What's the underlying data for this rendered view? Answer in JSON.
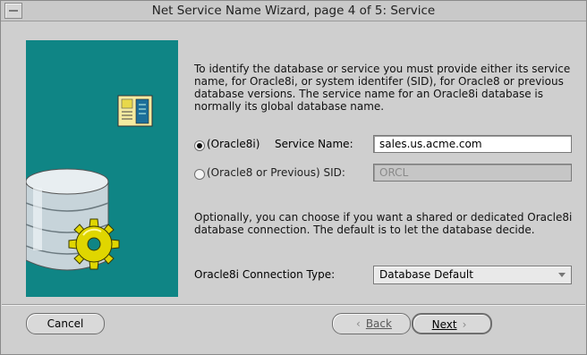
{
  "window": {
    "title": "Net Service Name Wizard, page 4 of 5: Service"
  },
  "intro_text": "To identify the database or service you must provide either its service name, for Oracle8i, or system identifer (SID), for Oracle8 or previous database versions. The service name for an Oracle8i database is normally its global database name.",
  "service_option": {
    "label_prefix": "(Oracle8i)",
    "label": "Service Name:",
    "value": "sales.us.acme.com",
    "selected": true
  },
  "sid_option": {
    "label": "(Oracle8 or Previous) SID:",
    "placeholder": "ORCL",
    "selected": false
  },
  "connection_text": "Optionally, you can choose if you want a shared or dedicated Oracle8i database connection. The default is to let the database decide.",
  "connection_type": {
    "label": "Oracle8i Connection Type:",
    "value": "Database Default"
  },
  "buttons": {
    "cancel": "Cancel",
    "back": "Back",
    "next": "Next"
  },
  "colors": {
    "art_panel": "#0f8585",
    "window_bg": "#cfcfcf"
  }
}
